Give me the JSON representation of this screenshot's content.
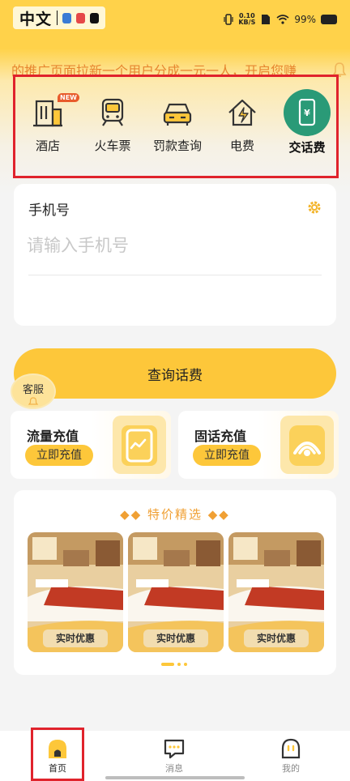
{
  "status_bar": {
    "lang": "中文",
    "net_speed_value": "0.10",
    "net_speed_unit": "KB/S",
    "battery": "99%"
  },
  "marquee": {
    "text": "的推广页面拉新一个用户分成一元一人，开启您赚"
  },
  "quick_nav": {
    "items": [
      {
        "label": "酒店",
        "icon": "hotel-icon",
        "badge": "NEW"
      },
      {
        "label": "火车票",
        "icon": "train-icon"
      },
      {
        "label": "罚款查询",
        "icon": "car-icon"
      },
      {
        "label": "电费",
        "icon": "electricity-icon"
      },
      {
        "label": "交话费",
        "icon": "phone-bill-icon"
      }
    ],
    "active_index": 4
  },
  "phone_form": {
    "label": "手机号",
    "placeholder": "请输入手机号",
    "value": ""
  },
  "query_button": "查询话费",
  "customer_service": "客服",
  "recharge": [
    {
      "title": "流量充值",
      "button": "立即充值",
      "icon": "data-plan-icon"
    },
    {
      "title": "固话充值",
      "button": "立即充值",
      "icon": "landline-icon"
    }
  ],
  "featured": {
    "title": "◆◆ 特价精选 ◆◆",
    "cards": [
      {
        "badge": "实时优惠"
      },
      {
        "badge": "实时优惠"
      },
      {
        "badge": "实时优惠"
      }
    ]
  },
  "tabs": [
    {
      "label": "首页",
      "icon": "home-icon"
    },
    {
      "label": "消息",
      "icon": "message-icon"
    },
    {
      "label": "我的",
      "icon": "profile-icon"
    }
  ],
  "colors": {
    "brand_yellow": "#fdc73a",
    "accent_green": "#2a9a77",
    "highlight_red": "#e0232c",
    "marquee_orange": "#e7862f"
  }
}
